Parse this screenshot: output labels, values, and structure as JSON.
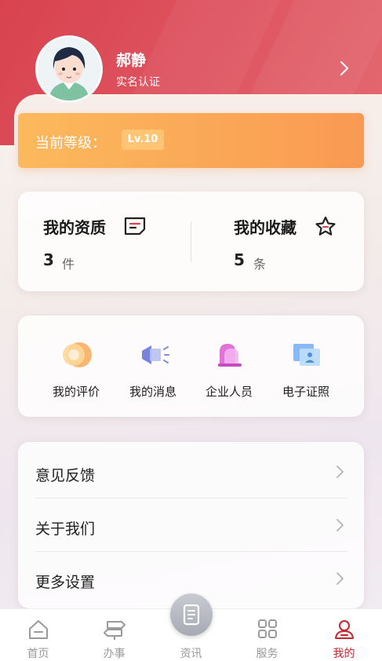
{
  "user": {
    "name": "郝静",
    "verify_status": "实名认证"
  },
  "level": {
    "label": "当前等级：",
    "badge": "Lv.10"
  },
  "stats": [
    {
      "title": "我的资质",
      "value": "3",
      "unit": "件",
      "icon": "certificate-icon"
    },
    {
      "title": "我的收藏",
      "value": "5",
      "unit": "条",
      "icon": "star-icon"
    }
  ],
  "shortcuts": [
    {
      "label": "我的评价",
      "icon": "review-icon"
    },
    {
      "label": "我的消息",
      "icon": "megaphone-icon"
    },
    {
      "label": "企业人员",
      "icon": "enterprise-staff-icon"
    },
    {
      "label": "电子证照",
      "icon": "e-license-icon"
    }
  ],
  "menu": [
    {
      "label": "意见反馈"
    },
    {
      "label": "关于我们"
    },
    {
      "label": "更多设置"
    }
  ],
  "tabs": [
    {
      "label": "首页",
      "icon": "home-icon"
    },
    {
      "label": "办事",
      "icon": "signpost-icon"
    },
    {
      "label": "资讯",
      "icon": "news-icon"
    },
    {
      "label": "服务",
      "icon": "grid-icon"
    },
    {
      "label": "我的",
      "icon": "user-icon",
      "active": true
    }
  ],
  "colors": {
    "brand_red": "#d8434f",
    "level_orange": "#f99a52",
    "active_tab": "#c8252f"
  }
}
